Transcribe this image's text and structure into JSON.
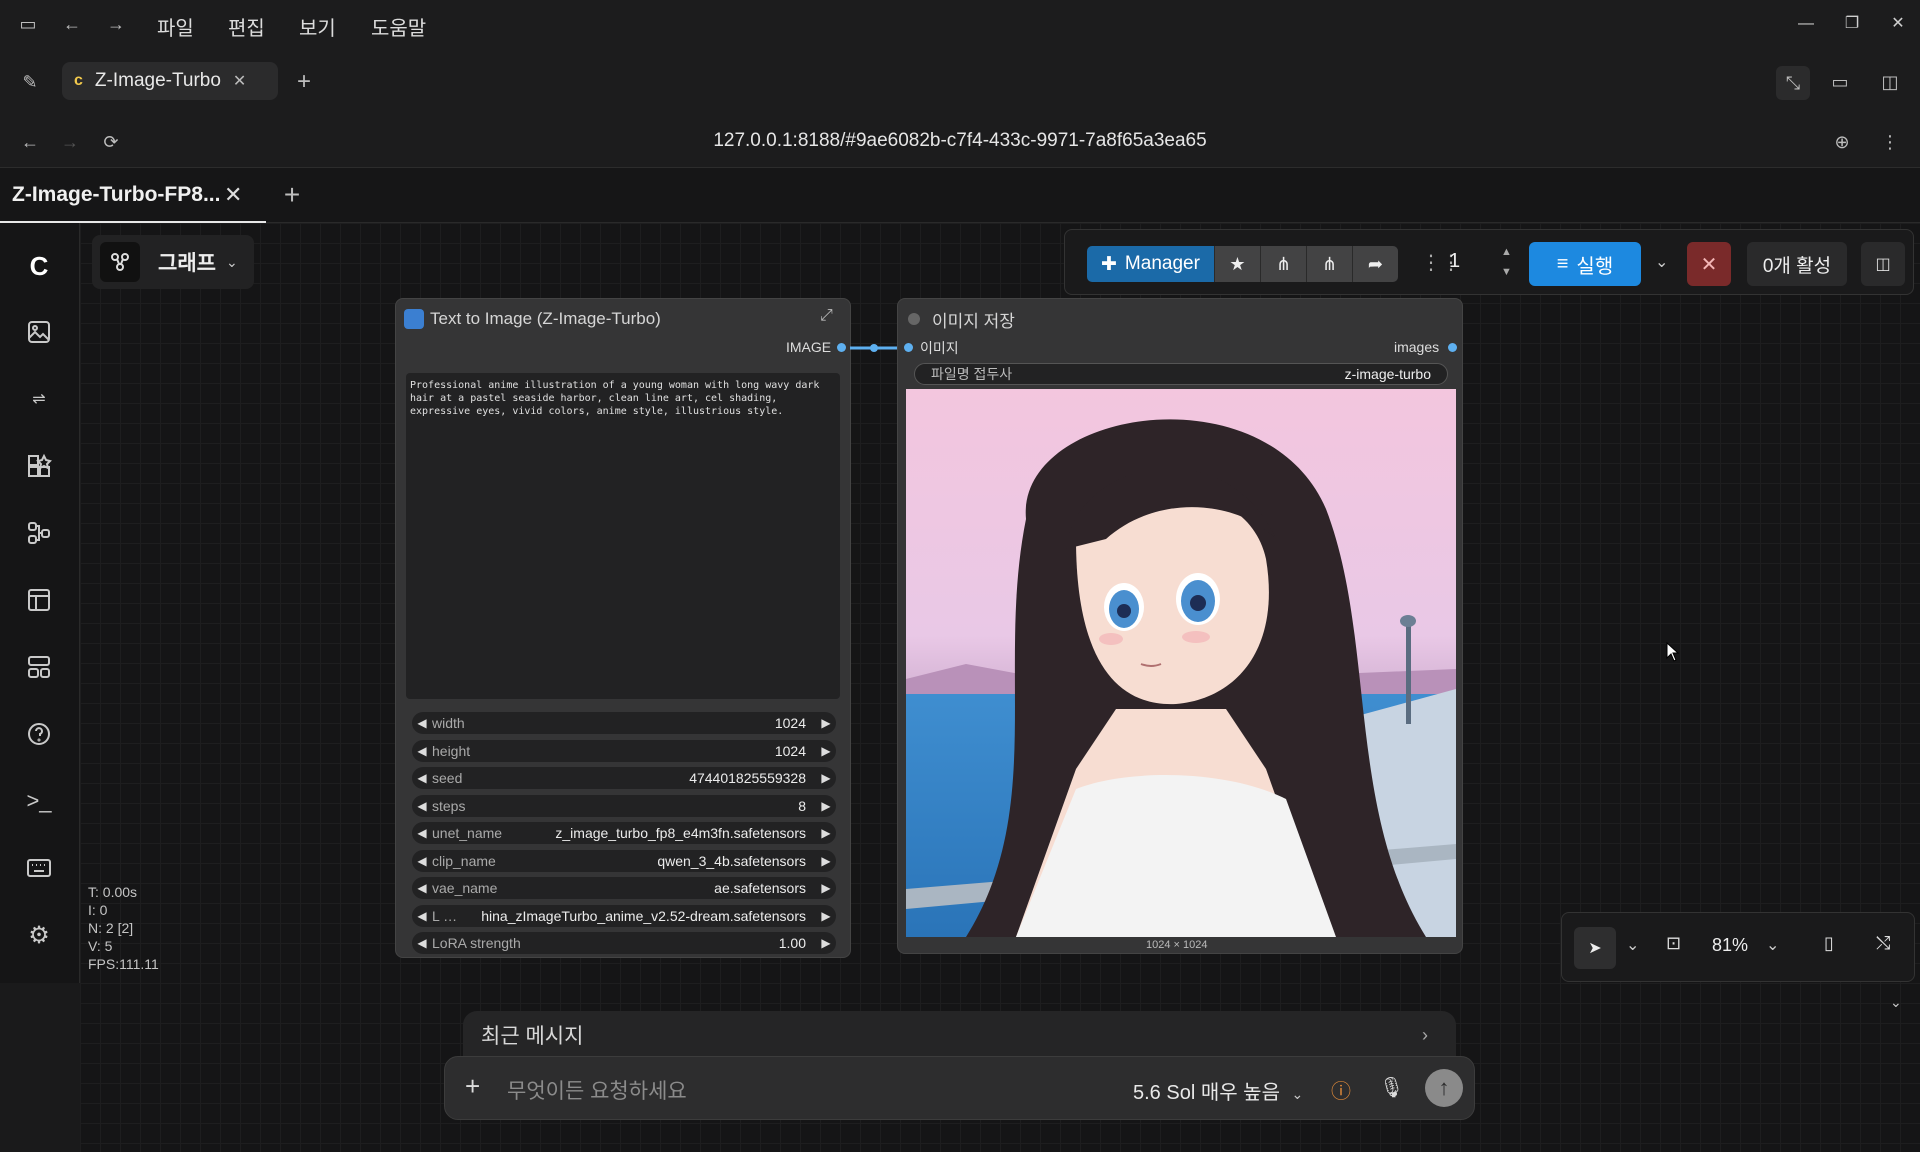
{
  "titlebar": {
    "menu": [
      "파일",
      "편집",
      "보기",
      "도움말"
    ]
  },
  "browser_tab": {
    "title": "Z-Image-Turbo"
  },
  "address": {
    "url": "127.0.0.1:8188/#9ae6082b-c7f4-433c-9971-7a8f65a3ea65"
  },
  "app_tab": {
    "title": "Z-Image-Turbo-FP8..."
  },
  "graph_button": {
    "label": "그래프"
  },
  "toolbar": {
    "manager_label": "Manager",
    "queue_count": "1",
    "run_label": "실행",
    "active_label": "0개 활성"
  },
  "node_text2image": {
    "title": "Text to Image (Z-Image-Turbo)",
    "output_label": "IMAGE",
    "prompt": "Professional anime illustration of a young woman with long wavy dark hair at a pastel seaside harbor, clean line art, cel shading, expressive eyes, vivid colors, anime style, illustrious style.",
    "widgets": [
      {
        "label": "width",
        "value": "1024"
      },
      {
        "label": "height",
        "value": "1024"
      },
      {
        "label": "seed",
        "value": "474401825559328"
      },
      {
        "label": "steps",
        "value": "8"
      },
      {
        "label": "unet_name",
        "value": "z_image_turbo_fp8_e4m3fn.safetensors"
      },
      {
        "label": "clip_name",
        "value": "qwen_3_4b.safetensors"
      },
      {
        "label": "vae_name",
        "value": "ae.safetensors"
      },
      {
        "label": "L …",
        "value": "hina_zImageTurbo_anime_v2.52-dream.safetensors"
      },
      {
        "label": "LoRA strength",
        "value": "1.00"
      }
    ]
  },
  "node_save": {
    "title": "이미지 저장",
    "input_label": "이미지",
    "output_label": "images",
    "prefix_label": "파일명 접두사",
    "prefix_value": "z-image-turbo",
    "image_size": "1024 × 1024"
  },
  "stats": {
    "t": "T: 0.00s",
    "i": "I: 0",
    "n": "N: 2 [2]",
    "v": "V: 5",
    "fps": "FPS:111.11"
  },
  "zoom": {
    "level": "81%"
  },
  "chat": {
    "recent_label": "최근 메시지",
    "placeholder": "무엇이든 요청하세요",
    "model_label": "5.6 Sol 매우 높음"
  },
  "colors": {
    "accent": "#1d89e0",
    "manager": "#1b6aa8",
    "stop": "#7a2a2a"
  }
}
